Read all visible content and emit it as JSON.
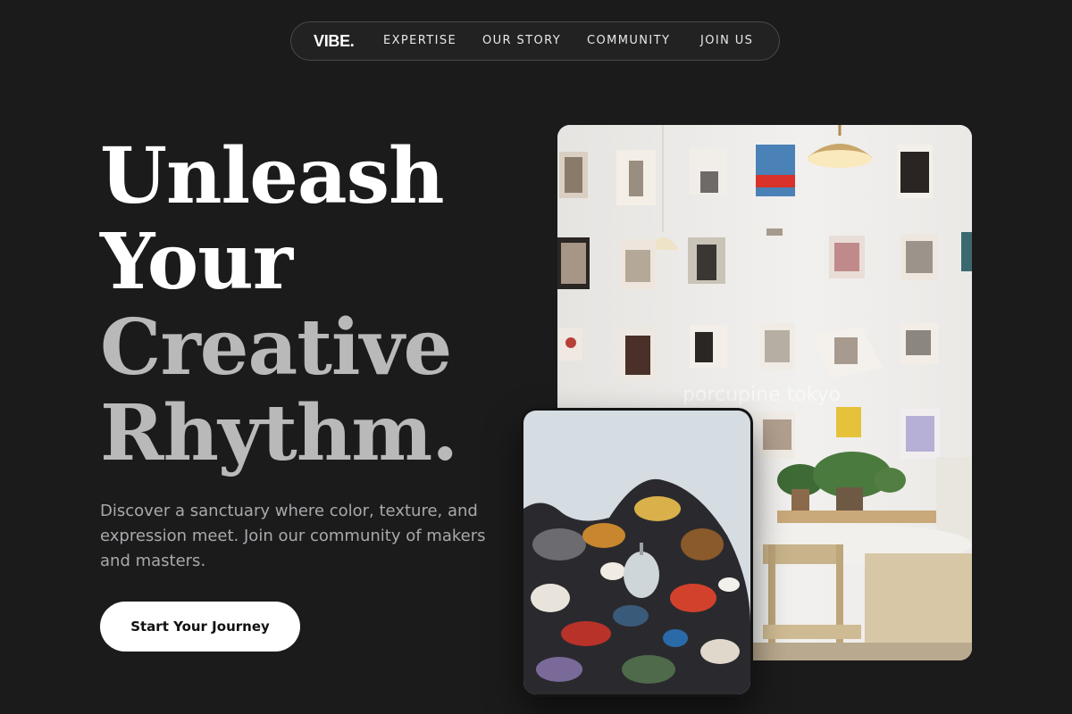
{
  "nav": {
    "logo": "VIBE.",
    "links": [
      "EXPERTISE",
      "OUR STORY",
      "COMMUNITY",
      "JOIN US"
    ]
  },
  "hero": {
    "headline": [
      "Unleash",
      "Your",
      "Creative",
      "Rhythm."
    ],
    "subtext": "Discover a sanctuary where color, texture, and expression meet. Join our community of makers and masters.",
    "cta_label": "Start Your Journey"
  },
  "images": {
    "wall_watermark": "porcupine tokyo"
  },
  "colors": {
    "background": "#1b1b1c",
    "headline_primary": "#ffffff",
    "headline_secondary": "#b9b9b9",
    "subtext": "#a9a9ad",
    "cta_bg": "#ffffff"
  }
}
